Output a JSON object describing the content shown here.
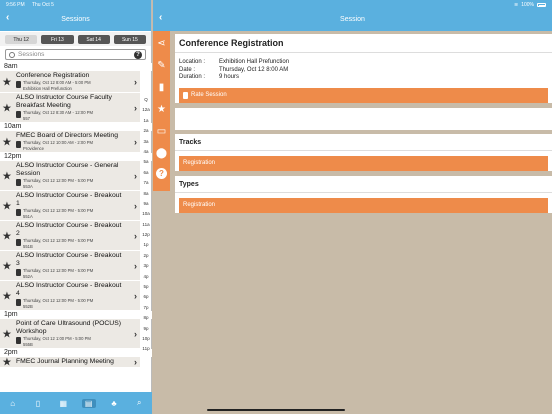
{
  "status": {
    "time": "9:56 PM",
    "date": "Thu Oct 5",
    "battery": "100%"
  },
  "left": {
    "title": "Sessions",
    "back": "‹",
    "days": [
      {
        "label": "Thu 12",
        "active": true
      },
      {
        "label": "Fri 13",
        "active": false
      },
      {
        "label": "Sat 14",
        "active": false
      },
      {
        "label": "Sun 15",
        "active": false
      }
    ],
    "search_placeholder": "Sessions",
    "help": "?",
    "index": [
      "Q",
      "12a",
      "1a",
      "2a",
      "3a",
      "4a",
      "5a",
      "6a",
      "7a",
      "8a",
      "9a",
      "10a",
      "11a",
      "12p",
      "1p",
      "2p",
      "3p",
      "4p",
      "5p",
      "6p",
      "7p",
      "8p",
      "9p",
      "10p",
      "11p"
    ]
  },
  "groups": [
    {
      "hour": "8am",
      "sessions": [
        {
          "title": "Conference Registration",
          "time": "Thursday, Oct 12 8:00 AM - 5:00 PM",
          "room": "Exhibition Hall Prefunction"
        },
        {
          "title": "ALSO Instructor Course Faculty Breakfast Meeting",
          "time": "Thursday, Oct 12 8:30 AM - 12:00 PM",
          "room": "557"
        }
      ]
    },
    {
      "hour": "10am",
      "sessions": [
        {
          "title": "FMEC Board of Directors Meeting",
          "time": "Thursday, Oct 12 10:00 AM - 2:00 PM",
          "room": "Providence"
        }
      ]
    },
    {
      "hour": "12pm",
      "sessions": [
        {
          "title": "ALSO Instructor Course  - General Session",
          "time": "Thursday, Oct 12 12:00 PM - 5:00 PM",
          "room": "553A"
        },
        {
          "title": "ALSO Instructor Course - Breakout 1",
          "time": "Thursday, Oct 12 12:00 PM - 5:00 PM",
          "room": "551A"
        },
        {
          "title": "ALSO Instructor Course - Breakout 2",
          "time": "Thursday, Oct 12 12:00 PM - 5:00 PM",
          "room": "551B"
        },
        {
          "title": "ALSO Instructor Course - Breakout 3",
          "time": "Thursday, Oct 12 12:00 PM - 5:00 PM",
          "room": "552A"
        },
        {
          "title": "ALSO Instructor Course - Breakout 4",
          "time": "Thursday, Oct 12 12:00 PM - 5:00 PM",
          "room": "552B"
        }
      ]
    },
    {
      "hour": "1pm",
      "sessions": [
        {
          "title": "Point of Care Ultrasound (POCUS) Workshop",
          "time": "Thursday, Oct 12 1:00 PM - 5:00 PM",
          "room": "555B"
        }
      ]
    },
    {
      "hour": "2pm",
      "sessions": [
        {
          "title": "FMEC Journal Planning Meeting",
          "time": "",
          "room": ""
        }
      ]
    }
  ],
  "right": {
    "title": "Session",
    "back": "‹",
    "session_title": "Conference Registration",
    "location_label": "Location :",
    "location": "Exhibition Hall Prefunction",
    "date_label": "Date :",
    "date": "Thursday, Oct 12 8:00 AM",
    "duration_label": "Duration :",
    "duration": "9 hours",
    "rate_label": "Rate Session",
    "notes_placeholder": " ",
    "tracks_header": "Tracks",
    "tracks_button": "Registration",
    "types_header": "Types",
    "types_button": "Registration"
  },
  "actions": [
    "share-icon",
    "edit-icon",
    "clipboard-icon",
    "star-icon",
    "chat-icon",
    "location-icon",
    "help-icon"
  ],
  "tabbar": [
    "home-icon",
    "phone-icon",
    "grid-icon",
    "calendar-icon",
    "people-icon",
    "search-icon"
  ],
  "colors": {
    "accent": "#5ab0df",
    "orange": "#ee8b4a"
  }
}
